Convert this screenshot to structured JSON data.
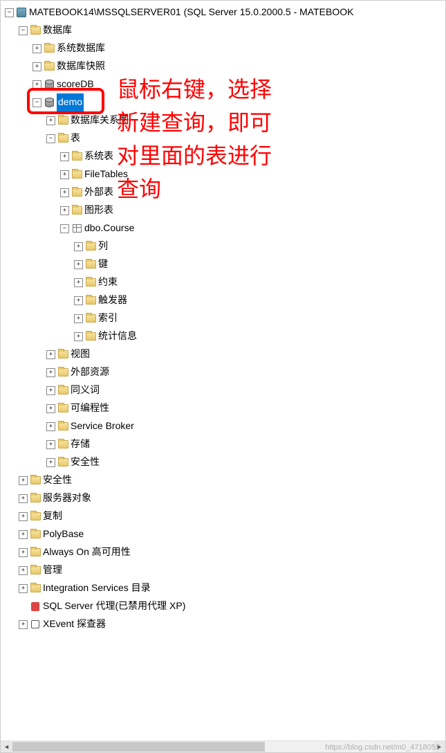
{
  "root": {
    "label": "MATEBOOK14\\MSSQLSERVER01 (SQL Server 15.0.2000.5 - MATEBOOK"
  },
  "l1": {
    "databases": "数据库",
    "security": "安全性",
    "server_objects": "服务器对象",
    "replication": "复制",
    "polybase": "PolyBase",
    "always_on": "Always On 高可用性",
    "management": "管理",
    "integration": "Integration Services 目录",
    "agent": "SQL Server 代理(已禁用代理 XP)",
    "xevent": "XEvent 探查器"
  },
  "db_children": {
    "system_db": "系统数据库",
    "snapshot": "数据库快照",
    "scoreDB": "scoreDB",
    "demo": "demo"
  },
  "demo_children": {
    "diagrams": "数据库关系图",
    "tables": "表",
    "views": "视图",
    "ext_res": "外部资源",
    "synonyms": "同义词",
    "programmability": "可编程性",
    "service_broker": "Service Broker",
    "storage": "存储",
    "security": "安全性"
  },
  "tables_children": {
    "system_tables": "系统表",
    "file_tables": "FileTables",
    "external_tables": "外部表",
    "graph_tables": "图形表",
    "dbo_course": "dbo.Course"
  },
  "course_children": {
    "columns": "列",
    "keys": "键",
    "constraints": "约束",
    "triggers": "触发器",
    "indexes": "索引",
    "statistics": "统计信息"
  },
  "annotation": {
    "line1": "鼠标右键，选择",
    "line2": "新建查询，即可",
    "line3": "对里面的表进行",
    "line4": "查询"
  },
  "watermark": "https://blog.csdn.net/m0_4718053"
}
